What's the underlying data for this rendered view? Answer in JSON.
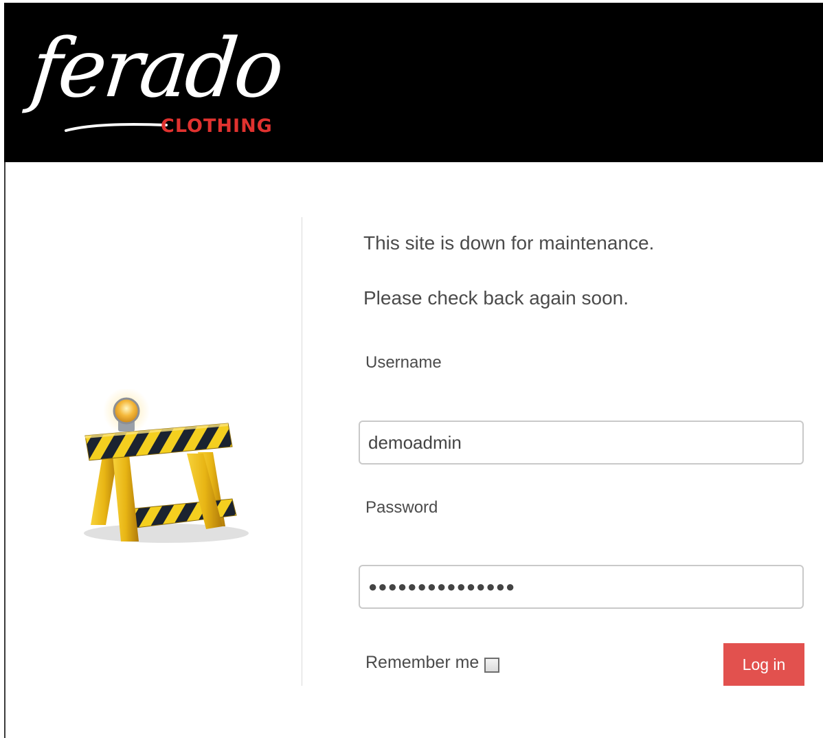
{
  "brand": {
    "logo_script": "ferado",
    "logo_sub": "CLOTHING",
    "logo_sub_color": "#e0322f",
    "header_bg": "#000000"
  },
  "illustration": {
    "icon": "construction-barrier-icon"
  },
  "maintenance": {
    "line1": "This site is down for maintenance.",
    "line2": "Please check back again soon."
  },
  "login_form": {
    "username_label": "Username",
    "username_value": "demoadmin",
    "password_label": "Password",
    "password_value": "●●●●●●●●●●●●●●●",
    "remember_label": "Remember me",
    "remember_checked": false,
    "submit_label": "Log in",
    "submit_color": "#e2514e"
  }
}
